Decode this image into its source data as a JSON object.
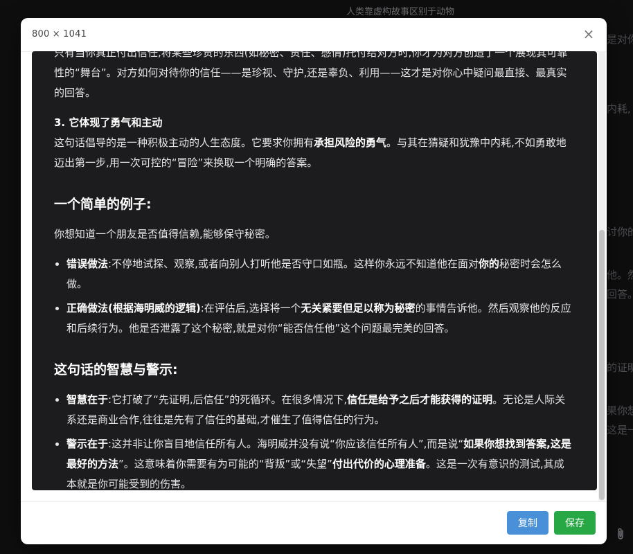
{
  "background": {
    "page_title": "人类靠虚构故事区别于动物",
    "fragments": [
      "是对你",
      "内耗,",
      "讨你的",
      "他。然",
      "回答。",
      "的证明",
      "果你想",
      "这是一"
    ]
  },
  "modal": {
    "title": "800 × 1041",
    "close_label": "×",
    "buttons": {
      "copy": "复制",
      "save": "保存"
    }
  },
  "content": {
    "partial_line_1": "只有当你真正付出信任,将某些珍贵的东西(如秘密、责任、感情)托付给对方时,你才为对方创造了一个",
    "partial_line_2": "展现其可靠性的“舞台”。对方如何对待你的信任——是珍视、守护,还是辜负、利用——这才是对你心中",
    "partial_line_3": "疑问最直接、最真实的回答。",
    "point3_title": "3. 它体现了勇气和主动",
    "point3_a": "这句话倡导的是一种积极主动的人生态度。它要求你拥有",
    "point3_bold": "承担风险的勇气",
    "point3_b": "。与其在猜疑和犹豫中内耗,不如勇敢地迈出第一步,用一次可控的“冒险”来换取一个明确的答案。",
    "example_heading": "一个简单的例子:",
    "example_intro": "你想知道一个朋友是否值得信赖,能够保守秘密。",
    "wrong_label": "错误做法",
    "wrong_a": ":不停地试探、观察,或者向别人打听他是否守口如瓶。这样你永远不知道他在面对",
    "wrong_bold": "你的",
    "wrong_b": "秘密时会怎么做。",
    "right_label": "正确做法(根据海明威的逻辑)",
    "right_a": ":在评估后,选择将一个",
    "right_bold": "无关紧要但足以称为秘密",
    "right_b": "的事情告诉他。然后观察他的反应和后续行为。他是否泄露了这个秘密,就是对你“能否信任他”这个问题最完美的回答。",
    "wisdom_heading": "这句话的智慧与警示:",
    "wisdom_label": "智慧在于",
    "wisdom_a": ":它打破了“先证明,后信任”的死循环。在很多情况下,",
    "wisdom_bold": "信任是给予之后才能获得的证明",
    "wisdom_b": "。无论是人际关系还是商业合作,往往是先有了信任的基础,才催生了值得信任的行为。",
    "warning_label": "警示在于",
    "warning_a": ":这并非让你盲目地信任所有人。海明威并没有说“你应该信任所有人”,而是说“",
    "warning_bold1": "如果你想找到答案,这是最好的方法",
    "warning_b": "”。这意味着你需要有为可能的“背叛”或“失望”",
    "warning_bold2": "付出代价的心理准备",
    "warning_c": "。这是一次有意识的测试,其成本就是你可能受到的伤害。"
  }
}
